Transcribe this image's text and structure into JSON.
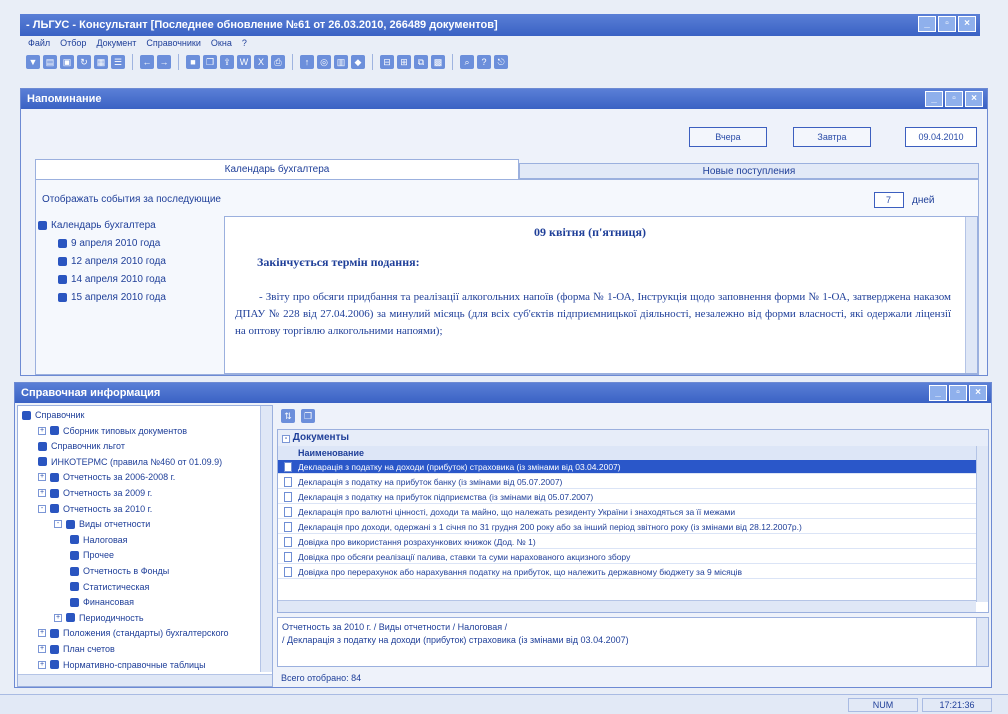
{
  "app_title": "- ЛЬГУС - Консультант [Последнее обновление №61 от 26.03.2010, 266489 документов]",
  "menu": [
    "Файл",
    "Отбор",
    "Документ",
    "Справочники",
    "Окна",
    "?"
  ],
  "notify": {
    "title": "Напоминание",
    "btn_yesterday": "Вчера",
    "btn_tomorrow": "Завтра",
    "date": "09.04.2010",
    "tabs": [
      "Календарь бухгалтера",
      "Новые поступления"
    ],
    "show_label": "Отображать события за последующие",
    "days_value": "7",
    "days_unit": "дней",
    "calendar": {
      "root": "Календарь бухгалтера",
      "items": [
        "9 апреля 2010 года",
        "12 апреля 2010 года",
        "14 апреля 2010 года",
        "15 апреля 2010 года"
      ]
    },
    "doc": {
      "heading": "09 квітня (п'ятниця)",
      "subheading": "Закінчується термін подання:",
      "paragraph": "- Звіту про обсяги придбання та реалізації алкогольних напоїв (форма № 1-ОА, Інструкція щодо заповнення форми № 1-ОА, затверджена наказом ДПАУ № 228 від 27.04.2006) за минулий місяць (для всіх суб'єктів підприємницької діяльності, незалежно від форми власності, які одержали ліцензії на оптову торгівлю алкогольними напоями);"
    }
  },
  "info": {
    "title": "Справочная информация",
    "tree": [
      {
        "label": "Справочник",
        "level": 0,
        "exp": ""
      },
      {
        "label": "Сборник типовых документов",
        "level": 1,
        "exp": "+"
      },
      {
        "label": "Справочник льгот",
        "level": 1,
        "exp": ""
      },
      {
        "label": "ИНКОТЕРМС (правила №460 от 01.09.9)",
        "level": 1,
        "exp": ""
      },
      {
        "label": "Отчетность за 2006-2008 г.",
        "level": 1,
        "exp": "+"
      },
      {
        "label": "Отчетность за 2009 г.",
        "level": 1,
        "exp": "+"
      },
      {
        "label": "Отчетность за 2010 г.",
        "level": 1,
        "exp": "-"
      },
      {
        "label": "Виды отчетности",
        "level": 2,
        "exp": "-"
      },
      {
        "label": "Налоговая",
        "level": 3,
        "exp": ""
      },
      {
        "label": "Прочее",
        "level": 3,
        "exp": ""
      },
      {
        "label": "Отчетность в Фонды",
        "level": 3,
        "exp": ""
      },
      {
        "label": "Статистическая",
        "level": 3,
        "exp": ""
      },
      {
        "label": "Финансовая",
        "level": 3,
        "exp": ""
      },
      {
        "label": "Периодичность",
        "level": 2,
        "exp": "+"
      },
      {
        "label": "Положения (стандарты) бухгалтерского",
        "level": 1,
        "exp": "+"
      },
      {
        "label": "План счетов",
        "level": 1,
        "exp": "+"
      },
      {
        "label": "Нормативно-справочные таблицы",
        "level": 1,
        "exp": "+"
      }
    ],
    "docs_header": "Документы",
    "col_header": "Наименование",
    "docs": [
      "Декларація з податку на доходи (прибуток) страховика (із змінами від 03.04.2007)",
      "Декларація з податку на прибуток банку (із змінами від 05.07.2007)",
      "Декларація з податку на прибуток підприємства (із змінами від 05.07.2007)",
      "Декларація про валютні цінності, доходи та майно, що належать резиденту України і знаходяться за її межами",
      "Декларація про доходи, одержані з 1 січня по 31 грудня 200 року або за інший період звітного року (із змінами від 28.12.2007р.)",
      "Довідка про використання розрахункових книжок (Дод. № 1)",
      "Довідка про обсяги реалізації палива, ставки та суми нарахованого акцизного збору",
      "Довідка про перерахунок або нарахування податку на прибуток, що належить державному бюджету за 9 місяців"
    ],
    "path": "Отчетность за 2010 г. / Виды отчетности / Налоговая /",
    "path_doc": "/ Декларація з податку на доходи (прибуток) страховика (із змінами від 03.04.2007)",
    "count": "Всего отобрано: 84"
  },
  "status": {
    "mode": "NUM",
    "time": "17:21:36"
  }
}
